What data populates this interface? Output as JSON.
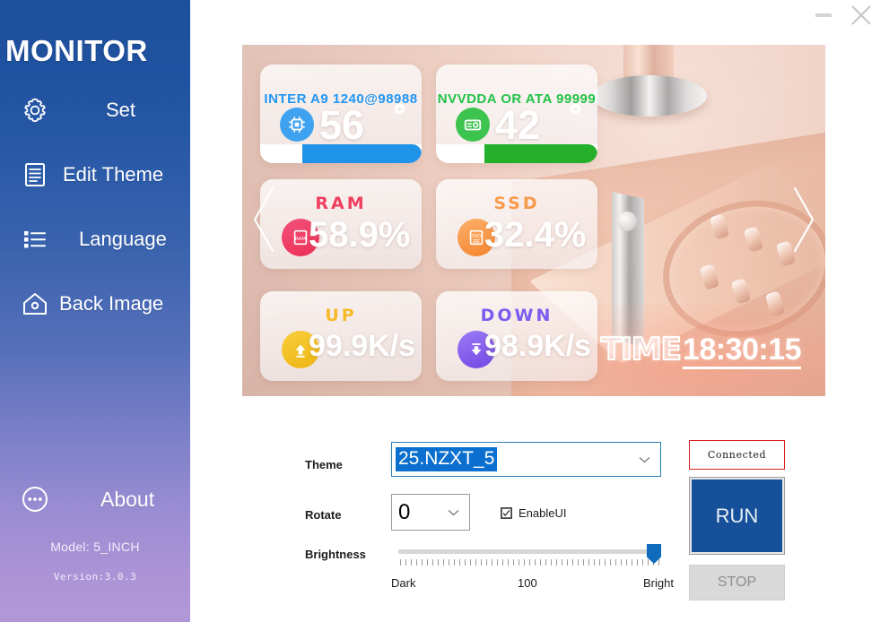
{
  "window": {
    "minimize_icon": "minimize-icon",
    "close_icon": "close-icon"
  },
  "sidebar": {
    "brand": "MONITOR",
    "items": [
      {
        "label": "Set",
        "icon": "gear-icon"
      },
      {
        "label": "Edit Theme",
        "icon": "document-icon"
      },
      {
        "label": "Language",
        "icon": "list-icon"
      },
      {
        "label": "Back Image",
        "icon": "home-image-icon"
      }
    ],
    "about": {
      "label": "About",
      "icon": "ellipsis-circle-icon"
    },
    "model": "Model:  5_INCH",
    "version": "Version:3.0.3"
  },
  "preview": {
    "prev_arrow_icon": "chevron-left-icon",
    "next_arrow_icon": "chevron-right-icon",
    "time": {
      "label": "TIME",
      "value": "18:30:15"
    },
    "cards": [
      {
        "name": "cpu",
        "title": "INTER A9 1240@98988",
        "title_color": "#2196f3",
        "value": "56",
        "unit": "degree",
        "icon": "cpu-chip-icon",
        "icon_color": "#3fa2f0",
        "bar_color": "#1f93e8",
        "bar_percent": 74
      },
      {
        "name": "gpu",
        "title": "NVVDDA OR ATA 99999",
        "title_color": "#22c247",
        "value": "42",
        "unit": "degree",
        "icon": "gpu-card-icon",
        "icon_color": "#3dc44f",
        "bar_color": "#24b02a",
        "bar_percent": 70
      },
      {
        "name": "ram",
        "title": "RAM",
        "title_color": "#ef3f5f",
        "value": "58.9%",
        "icon": "ram-stick-icon",
        "icon_color": "#f0446a"
      },
      {
        "name": "ssd",
        "title": "SSD",
        "title_color": "#f79a4b",
        "value": "32.4%",
        "icon": "ssd-drive-icon",
        "icon_color": "#f69544"
      },
      {
        "name": "up",
        "title": "UP",
        "title_color": "#f6b929",
        "value": "99.9K/s",
        "icon": "upload-arrow-icon",
        "icon_color": "#f2c318"
      },
      {
        "name": "down",
        "title": "DOWN",
        "title_color": "#7a5cf0",
        "value": "98.9K/s",
        "icon": "download-arrow-icon",
        "icon_color": "#8358e8"
      }
    ]
  },
  "controls": {
    "theme": {
      "label": "Theme",
      "value": "25.NZXT_5",
      "selected": true,
      "caret_icon": "chevron-down-icon"
    },
    "rotate": {
      "label": "Rotate",
      "value": "0",
      "caret_icon": "chevron-down-icon"
    },
    "enable_ui": {
      "label": "EnableUI",
      "checked": true
    },
    "brightness": {
      "label": "Brightness",
      "value": 100,
      "scale_min_label": "Dark",
      "scale_mid_label": "100",
      "scale_max_label": "Bright"
    },
    "status": {
      "text": "Connected",
      "border_color": "#d62020"
    },
    "run_button": "RUN",
    "stop_button": "STOP"
  }
}
